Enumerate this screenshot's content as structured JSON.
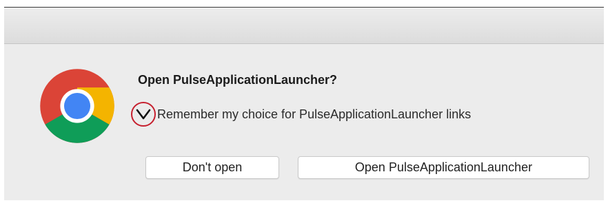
{
  "dialog": {
    "title": "Open PulseApplicationLauncher?",
    "remember_checkbox": {
      "label": "Remember my choice for PulseApplicationLauncher links",
      "checked": true
    },
    "buttons": {
      "dont_open": "Don't open",
      "open": "Open PulseApplicationLauncher"
    },
    "icon": "chrome-logo-icon"
  },
  "colors": {
    "chrome_red": "#db4437",
    "chrome_green": "#0f9d58",
    "chrome_yellow": "#f4b400",
    "chrome_blue": "#4285f4",
    "annotation_circle": "#c61f2e"
  }
}
